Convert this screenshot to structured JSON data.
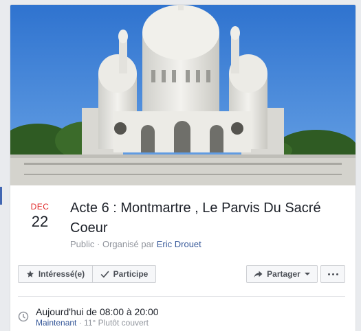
{
  "event": {
    "date": {
      "month": "DEC",
      "day": "22"
    },
    "title": "Acte 6 : Montmartre , Le Parvis Du Sacré Coeur",
    "privacy": "Public",
    "separator": " · ",
    "organized_by_label": "Organisé par ",
    "host": "Eric Drouet"
  },
  "actions": {
    "interested_label": "Intéressé(e)",
    "going_label": "Participe",
    "share_label": "Partager"
  },
  "details": {
    "time": "Aujourd'hui de 08:00 à 20:00",
    "now_label": "Maintenant",
    "weather": " · 11° Plutôt couvert"
  },
  "colors": {
    "accent": "#4267b2",
    "date_month": "#e02828",
    "link": "#365899",
    "sky": "#3f84d8"
  }
}
